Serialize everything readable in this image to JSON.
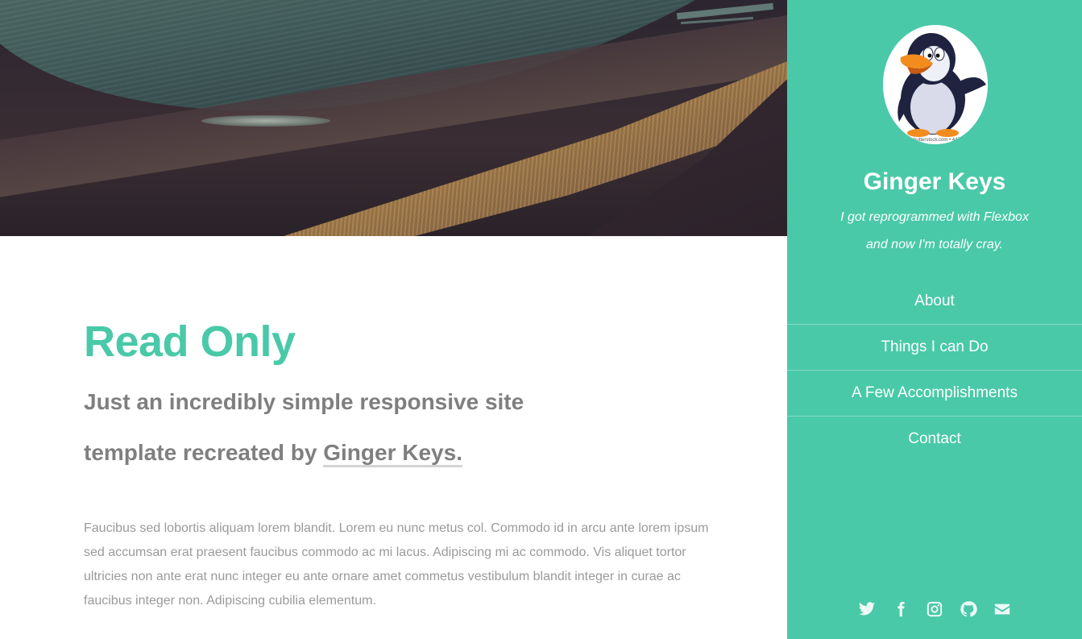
{
  "main": {
    "title": "Read Only",
    "subtitle_lead": "Just an incredibly simple responsive site template recreated by ",
    "subtitle_link": "Ginger Keys.",
    "body": "Faucibus sed lobortis aliquam lorem blandit. Lorem eu nunc metus col. Commodo id in arcu ante lorem ipsum sed accumsan erat praesent faucibus commodo ac mi lacus. Adipiscing mi ac commodo. Vis aliquet tortor ultricies non ante erat nunc integer eu ante ornare amet commetus vestibulum blandit integer in curae ac faucibus integer non. Adipiscing cubilia elementum."
  },
  "sidebar": {
    "avatar_icon": "penguin-avatar",
    "avatar_watermark": "shutterstock.com • 447",
    "name": "Ginger Keys",
    "tagline_line1": "I got reprogrammed with Flexbox",
    "tagline_line2": "and now I'm totally cray.",
    "nav": [
      {
        "label": "About"
      },
      {
        "label": "Things I can Do"
      },
      {
        "label": "A Few Accomplishments"
      },
      {
        "label": "Contact"
      }
    ],
    "social": [
      "twitter-icon",
      "facebook-icon",
      "instagram-icon",
      "github-icon",
      "envelope-icon"
    ]
  },
  "colors": {
    "accent": "#49c9a8",
    "text_gray": "#7f7f7f",
    "body_gray": "#9a9a9a",
    "sidebar_text": "#ffffff"
  }
}
